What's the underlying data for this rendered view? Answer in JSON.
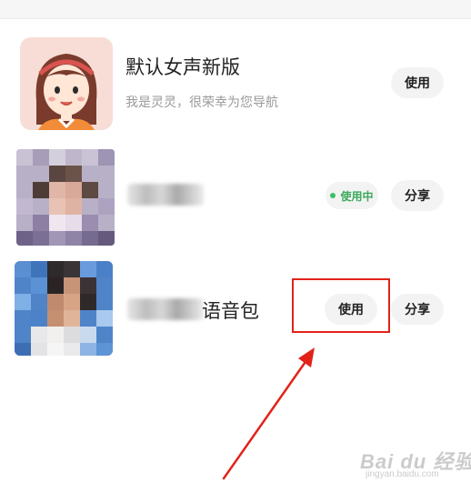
{
  "items": [
    {
      "title": "默认女声新版",
      "subtitle": "我是灵灵，很荣幸为您导航",
      "use_label": "使用"
    },
    {
      "status_label": "使用中",
      "share_label": "分享"
    },
    {
      "title": "语音包",
      "use_label": "使用",
      "share_label": "分享"
    }
  ],
  "watermark": {
    "text": "Bai du 经验",
    "sub": "jingyan.baidu.com"
  },
  "colors": {
    "highlight": "#e2231a",
    "status_green": "#3cc168",
    "pill_bg": "#f3f3f3"
  }
}
